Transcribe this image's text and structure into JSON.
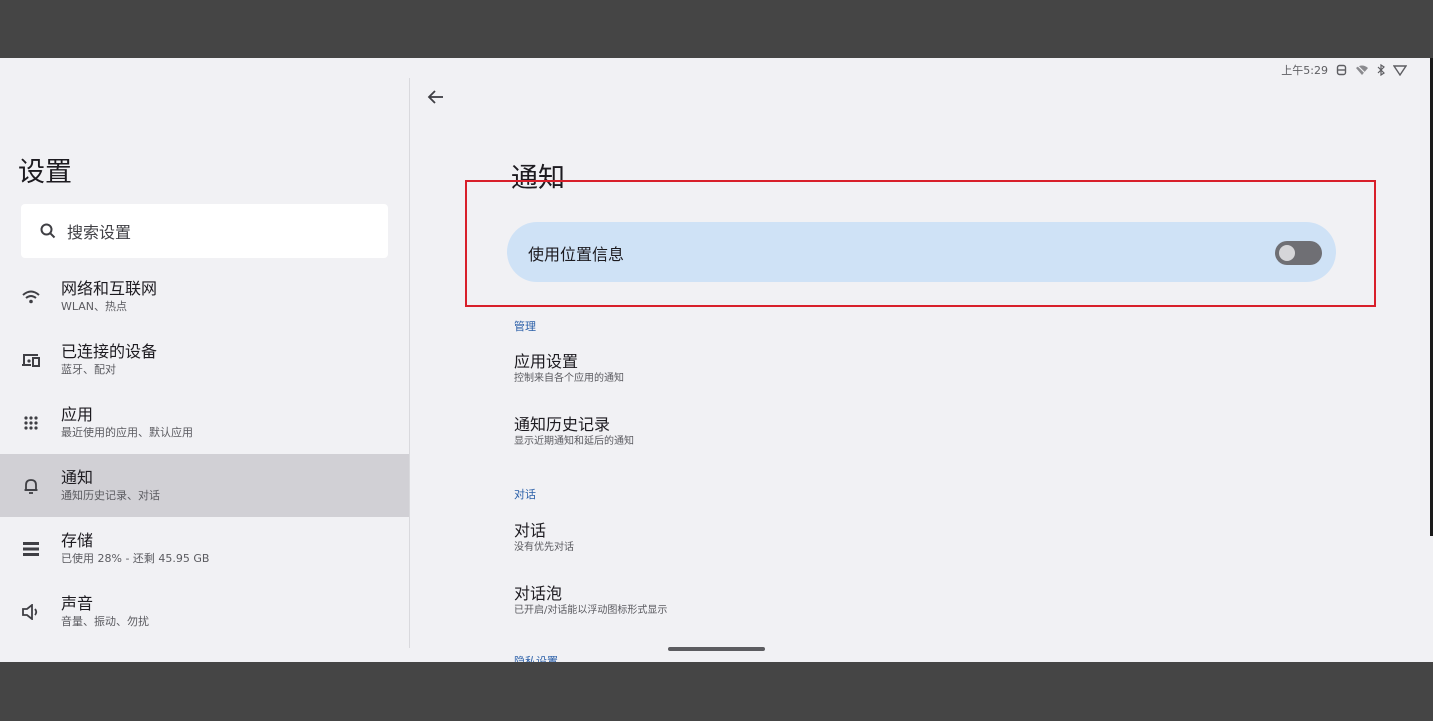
{
  "status_bar": {
    "time": "上午5:29"
  },
  "left_panel": {
    "title": "设置",
    "search": {
      "placeholder": "搜索设置"
    },
    "nav_items": [
      {
        "title": "网络和互联网",
        "subtitle": "WLAN、热点",
        "icon": "wifi-icon"
      },
      {
        "title": "已连接的设备",
        "subtitle": "蓝牙、配对",
        "icon": "connected-devices-icon"
      },
      {
        "title": "应用",
        "subtitle": "最近使用的应用、默认应用",
        "icon": "apps-grid-icon"
      },
      {
        "title": "通知",
        "subtitle": "通知历史记录、对话",
        "icon": "bell-icon",
        "active": true
      },
      {
        "title": "存储",
        "subtitle": "已使用 28% - 还剩 45.95 GB",
        "icon": "storage-icon"
      },
      {
        "title": "声音",
        "subtitle": "音量、振动、勿扰",
        "icon": "volume-icon"
      }
    ]
  },
  "main": {
    "title": "通知",
    "master_toggle": {
      "label": "使用位置信息",
      "on": false
    },
    "sections": [
      {
        "label": "管理",
        "items": [
          {
            "title": "应用设置",
            "subtitle": "控制来自各个应用的通知"
          },
          {
            "title": "通知历史记录",
            "subtitle": "显示近期通知和延后的通知"
          }
        ]
      },
      {
        "label": "对话",
        "items": [
          {
            "title": "对话",
            "subtitle": "没有优先对话"
          },
          {
            "title": "对话泡",
            "subtitle": "已开启/对话能以浮动图标形式显示"
          }
        ]
      },
      {
        "label": "隐私设置",
        "items": []
      }
    ]
  },
  "colors": {
    "accent": "#2a5fa8",
    "highlight_border": "#d81f2a",
    "active_nav_bg": "#d1d0d5",
    "toggle_row_bg": "#cfe2f6"
  }
}
